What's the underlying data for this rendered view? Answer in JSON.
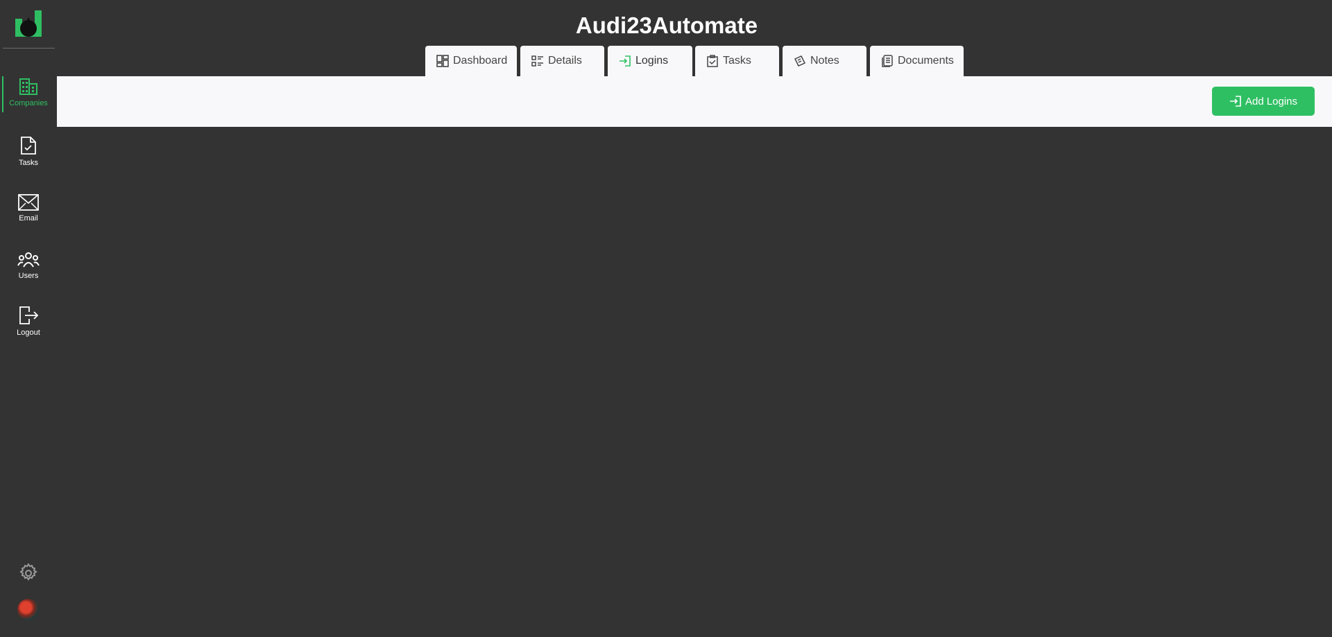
{
  "app": {
    "title": "Audi23Automate"
  },
  "sidebar": {
    "items": [
      {
        "label": "Companies",
        "icon": "building-icon"
      },
      {
        "label": "Tasks",
        "icon": "task-file-icon"
      },
      {
        "label": "Email",
        "icon": "envelope-icon"
      },
      {
        "label": "Users",
        "icon": "users-icon"
      },
      {
        "label": "Logout",
        "icon": "logout-icon"
      }
    ],
    "active": "Companies"
  },
  "tabs": [
    {
      "label": "Dashboard",
      "icon": "dashboard-icon"
    },
    {
      "label": "Details",
      "icon": "details-list-icon"
    },
    {
      "label": "Logins",
      "icon": "login-icon"
    },
    {
      "label": "Tasks",
      "icon": "clipboard-check-icon"
    },
    {
      "label": "Notes",
      "icon": "notes-icon"
    },
    {
      "label": "Documents",
      "icon": "documents-icon"
    }
  ],
  "active_tab": "Logins",
  "toolbar": {
    "add_label": "Add Logins"
  },
  "colors": {
    "accent": "#2fbf63",
    "background": "#333333",
    "panel": "#f8f8fa"
  }
}
